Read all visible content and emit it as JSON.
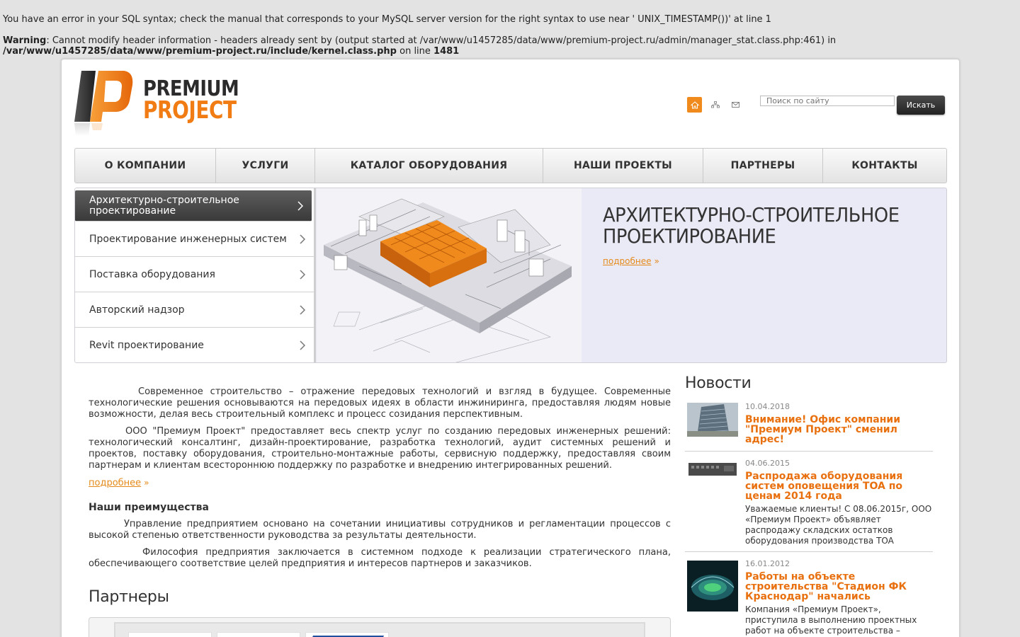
{
  "errors": {
    "sql_error": "You have an error in your SQL syntax; check the manual that corresponds to your MySQL server version for the right syntax to use near ' UNIX_TIMESTAMP())' at line 1",
    "warning_label": "Warning",
    "warning_text": ": Cannot modify header information - headers already sent by (output started at /var/www/u1457285/data/www/premium-project.ru/admin/manager_stat.class.php:461) in ",
    "warning_file": "/var/www/u1457285/data/www/premium-project.ru/include/kernel.class.php",
    "warning_online": " on line ",
    "warning_line": "1481"
  },
  "logo": {
    "line1": "PREMIUM",
    "line2": "PROJECT",
    "brand_color": "#f07c13"
  },
  "header": {
    "icons": [
      "home-icon",
      "sitemap-icon",
      "mail-icon"
    ],
    "search_placeholder": "Поиск по сайту",
    "search_button": "Искать"
  },
  "nav": [
    {
      "label": "О КОМПАНИИ"
    },
    {
      "label": "УСЛУГИ"
    },
    {
      "label": "КАТАЛОГ ОБОРУДОВАНИЯ"
    },
    {
      "label": "НАШИ ПРОЕКТЫ"
    },
    {
      "label": "ПАРТНЕРЫ"
    },
    {
      "label": "КОНТАКТЫ"
    }
  ],
  "side_menu": [
    {
      "label": "Архитектурно-строительное проектирование",
      "active": true
    },
    {
      "label": "Проектирование инженерных систем"
    },
    {
      "label": "Поставка оборудования"
    },
    {
      "label": "Авторский надзор"
    },
    {
      "label": "Revit проектирование"
    }
  ],
  "slide": {
    "title": "АРХИТЕКТУРНО-СТРОИТЕЛЬНОЕ ПРОЕКТИРОВАНИЕ",
    "more": "подробнее",
    "raquo": "»"
  },
  "content": {
    "p1": "Современное строительство – отражение передовых технологий и взгляд в будущее. Современные технологические решения основываются на передовых идеях в области инжиниринга, предоставляя людям новые возможности, делая весь строительный комплекс и процесс созидания перспективным.",
    "p2": "ООО \"Премиум Проект\" предоставляет весь спектр услуг по созданию передовых инженерных решений: технологический консалтинг, дизайн-проектирование, разработка технологий, аудит системных решений и проектов, поставку оборудования, строительно-монтажные работы, сервисную поддержку, предоставляя своим партнерам и клиентам всестороннюю поддержку по разработке и внедрению интегрированных решений.",
    "more": "подробнее",
    "raquo": "»",
    "adv_heading": "Наши преимущества",
    "p3": "Управление предприятием основано на сочетании инициативы сотрудников и регламентации процессов с высокой степенью ответственности руководства за результаты деятельности.",
    "p4": "Философия предприятия заключается в системном подходе к реализации стратегического плана, обеспечивающего соответствие целей предприятия и интересов партнеров и заказчиков.",
    "partners_heading": "Партнеры"
  },
  "news": {
    "heading": "Новости",
    "items": [
      {
        "date": "10.04.2018",
        "title": "Внимание! Офис компании \"Премиум Проект\" сменил адрес!",
        "text": ""
      },
      {
        "date": "04.06.2015",
        "title": "Распродажа оборудования систем оповещения TOA по ценам 2014 года",
        "text": "Уважаемые клиенты! С 08.06.2015г, ООО «Премиум Проект» объявляет распродажу складских остатков оборудования производства TOA"
      },
      {
        "date": "16.01.2012",
        "title": "Работы на объекте строительства \"Стадион ФК Краснодар\" начались",
        "text": "Компания «Премиум Проект», приступила в выполнению проектных работ на объекте строительства –"
      }
    ]
  }
}
